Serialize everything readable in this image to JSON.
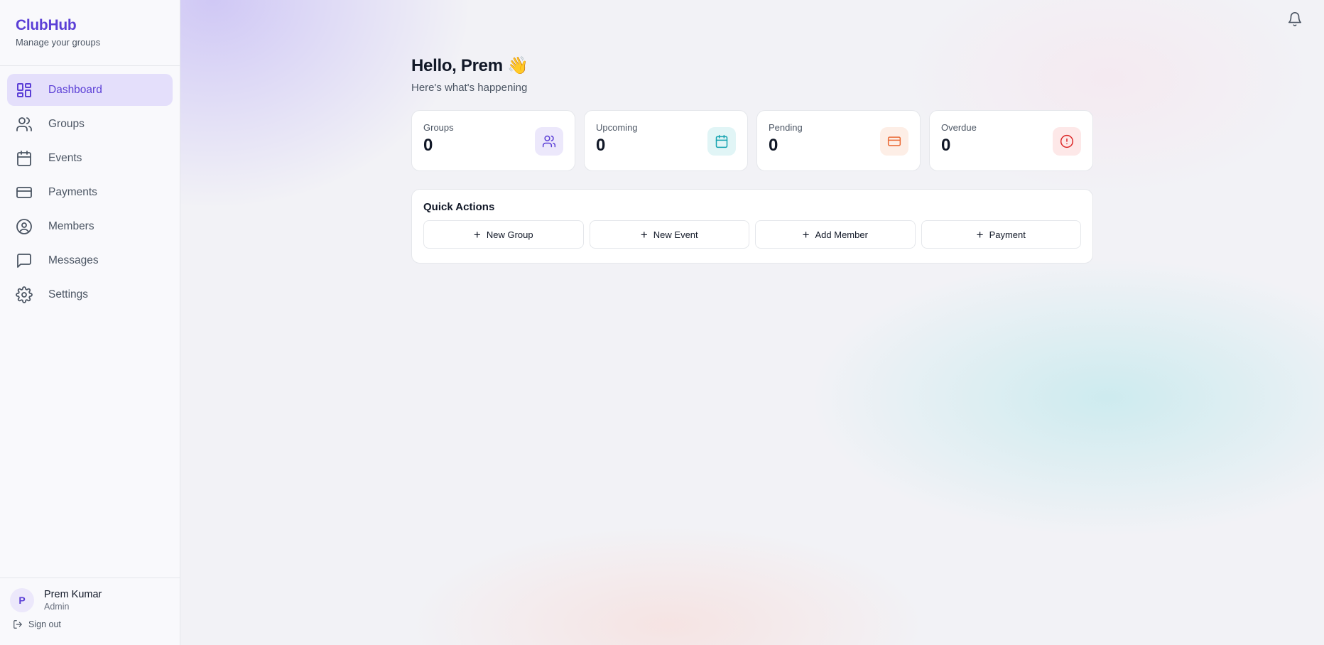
{
  "brand": {
    "title": "ClubHub",
    "subtitle": "Manage your groups"
  },
  "sidebar": {
    "items": [
      {
        "label": "Dashboard",
        "icon": "dashboard-icon",
        "active": true
      },
      {
        "label": "Groups",
        "icon": "users-icon"
      },
      {
        "label": "Events",
        "icon": "calendar-icon"
      },
      {
        "label": "Payments",
        "icon": "credit-card-icon"
      },
      {
        "label": "Members",
        "icon": "user-circle-icon"
      },
      {
        "label": "Messages",
        "icon": "message-square-icon"
      },
      {
        "label": "Settings",
        "icon": "gear-icon"
      }
    ]
  },
  "user": {
    "initial": "P",
    "name": "Prem Kumar",
    "role": "Admin",
    "signout": "Sign out"
  },
  "header": {
    "greeting": "Hello, Prem 👋",
    "subtitle": "Here's what's happening"
  },
  "stats": [
    {
      "label": "Groups",
      "value": "0",
      "icon": "users-icon",
      "color": "#5b3fd6",
      "bg": "#ece8fb"
    },
    {
      "label": "Upcoming",
      "value": "0",
      "icon": "calendar-icon",
      "color": "#14a3b0",
      "bg": "#e1f5f6"
    },
    {
      "label": "Pending",
      "value": "0",
      "icon": "credit-card-icon",
      "color": "#ea6a35",
      "bg": "#fdeee6"
    },
    {
      "label": "Overdue",
      "value": "0",
      "icon": "alert-circle-icon",
      "color": "#dc2626",
      "bg": "#fde8e8"
    }
  ],
  "quick_actions": {
    "title": "Quick Actions",
    "buttons": [
      "New Group",
      "New Event",
      "Add Member",
      "Payment"
    ]
  },
  "colors": {
    "accent": "#5b3fd6",
    "active_bg": "#e4dffb"
  }
}
